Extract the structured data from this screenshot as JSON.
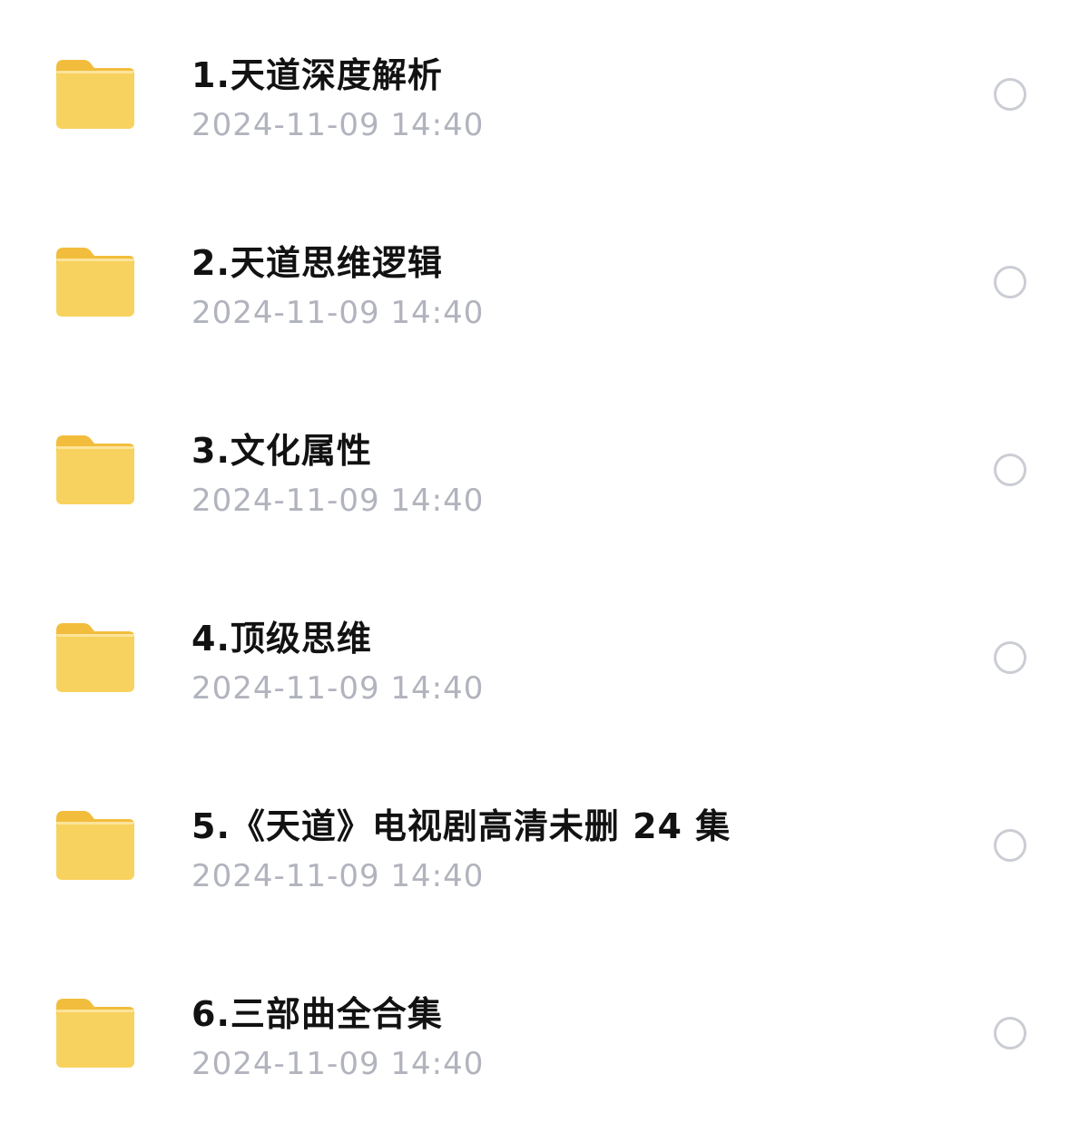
{
  "files": [
    {
      "name": "1.天道深度解析",
      "date": "2024-11-09 14:40",
      "icon": "folder-icon"
    },
    {
      "name": "2.天道思维逻辑",
      "date": "2024-11-09 14:40",
      "icon": "folder-icon"
    },
    {
      "name": "3.文化属性",
      "date": "2024-11-09 14:40",
      "icon": "folder-icon"
    },
    {
      "name": "4.顶级思维",
      "date": "2024-11-09 14:40",
      "icon": "folder-icon"
    },
    {
      "name": "5.《天道》电视剧高清未删 24 集",
      "date": "2024-11-09 14:40",
      "icon": "folder-icon"
    },
    {
      "name": "6.三部曲全合集",
      "date": "2024-11-09 14:40",
      "icon": "folder-icon"
    }
  ],
  "colors": {
    "folder_body": "#f8d25e",
    "folder_back": "#f2bd3c",
    "title_text": "#121212",
    "date_text": "#b1b3bd",
    "select_circle": "#cbcdd4"
  }
}
